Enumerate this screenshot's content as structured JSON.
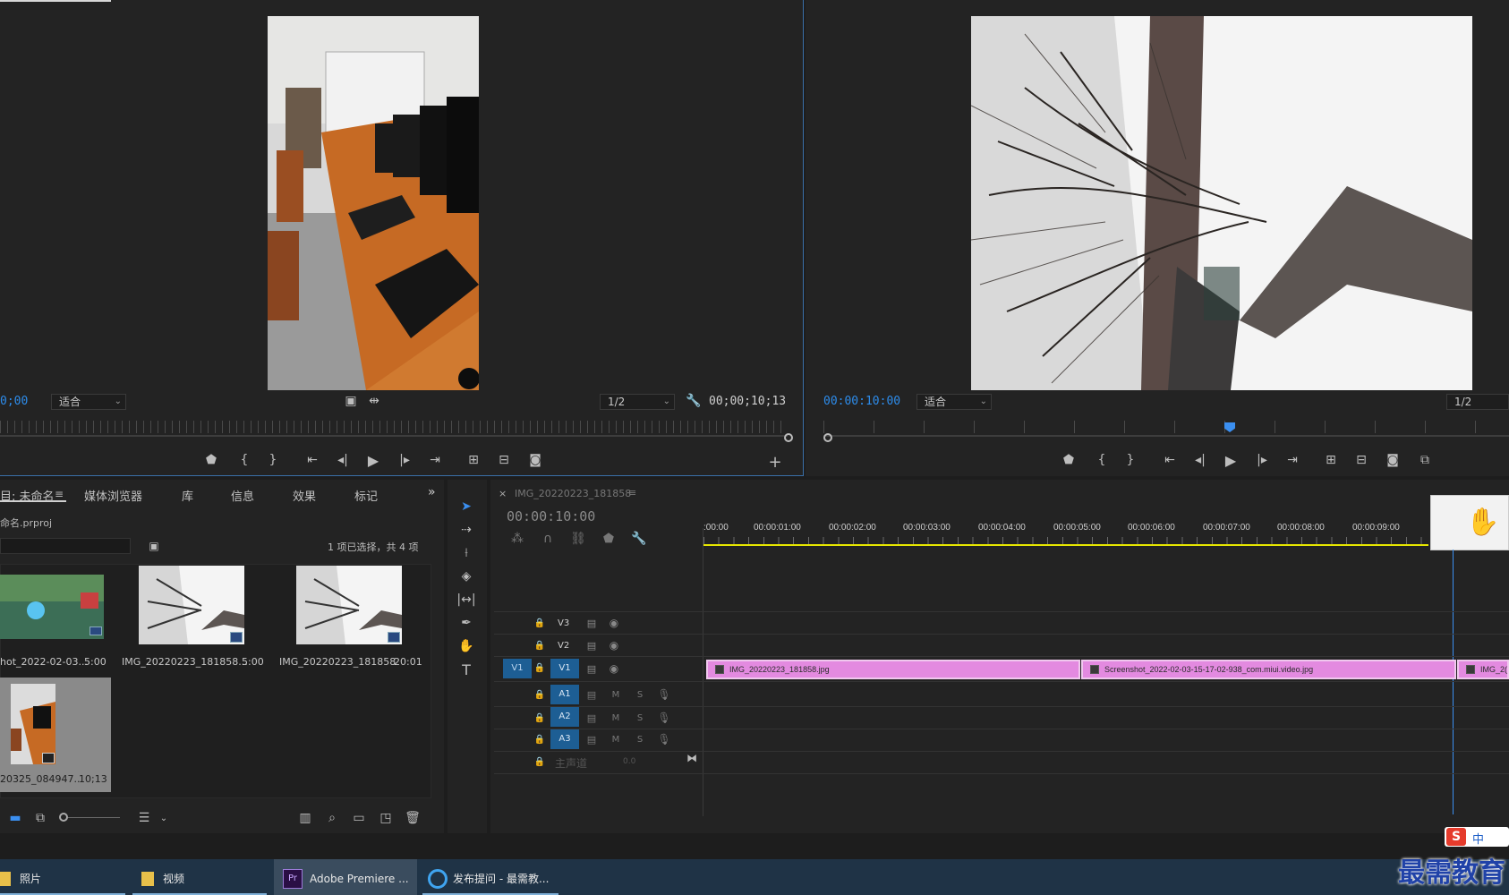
{
  "source_monitor": {
    "timecode_left": "0;00",
    "fit_label": "适合",
    "resolution": "1/2",
    "duration": "00;00;10;13"
  },
  "program_monitor": {
    "timecode": "00:00:10:00",
    "fit_label": "适合",
    "resolution": "1/2"
  },
  "project_panel": {
    "tabs": [
      "目: 未命名",
      "媒体浏览器",
      "库",
      "信息",
      "效果",
      "标记"
    ],
    "project_file": "命名.prproj",
    "selection_info": "1 项已选择，共 4 项",
    "items": [
      {
        "name": "hot_2022-02-03...",
        "duration": "5:00"
      },
      {
        "name": "IMG_20220223_181858...",
        "duration": "5:00"
      },
      {
        "name": "IMG_20220223_181858",
        "duration": "20:01"
      },
      {
        "name": "20325_084947...",
        "duration": "10;13"
      }
    ]
  },
  "timeline": {
    "sequence_name": "IMG_20220223_181858",
    "timecode": "00:00:10:00",
    "ruler": [
      ":00:00",
      "00:00:01:00",
      "00:00:02:00",
      "00:00:03:00",
      "00:00:04:00",
      "00:00:05:00",
      "00:00:06:00",
      "00:00:07:00",
      "00:00:08:00",
      "00:00:09:00"
    ],
    "video_tracks": [
      "V3",
      "V2",
      "V1"
    ],
    "audio_tracks": [
      "A1",
      "A2",
      "A3"
    ],
    "source_patch": "V1",
    "master_label": "主声道",
    "master_value": "0.0",
    "mute_label": "M",
    "solo_label": "S",
    "clips": [
      {
        "name": "IMG_20220223_181858.jpg"
      },
      {
        "name": "Screenshot_2022-02-03-15-17-02-938_com.miui.video.jpg"
      },
      {
        "name": "IMG_2("
      }
    ]
  },
  "taskbar": {
    "items": [
      "照片",
      "视频",
      "Adobe Premiere ...",
      "发布提问 - 最需教..."
    ],
    "pr_badge": "Pr"
  },
  "watermark": "最需教育",
  "ime": {
    "label": "中"
  },
  "colors": {
    "accent_blue": "#2d8ceb",
    "clip_pink": "#e38ae0",
    "timeline_yellow": "#e6e600",
    "panel_bg": "#232323"
  }
}
